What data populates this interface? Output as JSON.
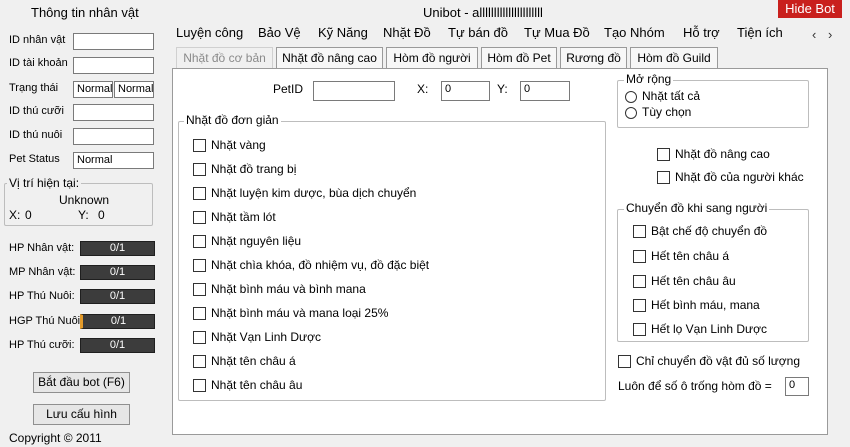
{
  "left": {
    "title": "Thông tin nhân vật",
    "fields": [
      {
        "label": "ID nhân vật",
        "value": ""
      },
      {
        "label": "ID tài khoản",
        "value": ""
      },
      {
        "label": "Trạng thái",
        "value1": "Normal",
        "value2": "Normal"
      },
      {
        "label": "ID thú cưỡi",
        "value": ""
      },
      {
        "label": "ID thú nuôi",
        "value": ""
      },
      {
        "label": "Pet Status",
        "value": "Normal"
      }
    ],
    "position": {
      "legend": "Vị trí hiện tại:",
      "map": "Unknown",
      "x_label": "X:",
      "x_value": "0",
      "y_label": "Y:",
      "y_value": "0"
    },
    "bars": [
      {
        "label": "HP Nhân vật:",
        "value": "0/1"
      },
      {
        "label": "MP Nhân vật:",
        "value": "0/1"
      },
      {
        "label": "HP Thú Nuôi:",
        "value": "0/1"
      },
      {
        "label": "HGP Thú Nuôi:",
        "value": "0/1"
      },
      {
        "label": "HP Thú cưỡi:",
        "value": "0/1"
      }
    ],
    "start_button": "Bắt đầu bot (F6)",
    "save_button": "Lưu cấu hình",
    "copyright": "Copyright © 2011"
  },
  "window": {
    "title": "Unibot - allllllllllllllllllllll",
    "hide_button": "Hide Bot"
  },
  "menu": [
    "Luyện công",
    "Bảo Vệ",
    "Kỹ Năng",
    "Nhặt Đồ",
    "Tự bán đồ",
    "Tự Mua Đồ",
    "Tạo Nhóm",
    "Hỗ trợ",
    "Tiện ích"
  ],
  "tabs": [
    "Nhặt đồ cơ bản",
    "Nhặt đồ nâng cao",
    "Hòm đồ người",
    "Hòm đồ Pet",
    "Rương đồ",
    "Hòm đồ Guild"
  ],
  "content": {
    "petid_label": "PetID",
    "petid_value": "",
    "x_label": "X:",
    "x_value": "0",
    "y_label": "Y:",
    "y_value": "0",
    "simple_group": "Nhặt đồ đơn giản",
    "simple_items": [
      "Nhặt vàng",
      "Nhặt đồ trang bị",
      "Nhặt luyện kim dược, bùa dịch chuyển",
      "Nhặt tầm lót",
      "Nhặt nguyên liệu",
      "Nhặt chìa khóa, đồ nhiệm vụ,  đồ đặc biệt",
      "Nhặt bình máu và bình mana",
      "Nhặt bình máu và mana loại 25%",
      "Nhặt Vạn Linh Dược",
      "Nhặt tên châu á",
      "Nhặt tên châu âu"
    ],
    "expand_group": "Mở rộng",
    "expand_options": [
      "Nhặt tất cả",
      "Tùy chọn"
    ],
    "extra_items": [
      "Nhặt đồ nâng cao",
      "Nhặt đồ của người khác"
    ],
    "transfer_group": "Chuyển đồ khi sang người",
    "transfer_items": [
      "Bật chế độ chuyển đồ",
      "Hết tên châu á",
      "Hết tên châu âu",
      "Hết bình máu, mana",
      "Hết lọ Vạn Linh Dược"
    ],
    "only_enough": "Chỉ chuyển đồ vật đủ số lượng",
    "keep_slots_label": "Luôn để số ô trống  hòm đồ =",
    "keep_slots_value": "0"
  }
}
